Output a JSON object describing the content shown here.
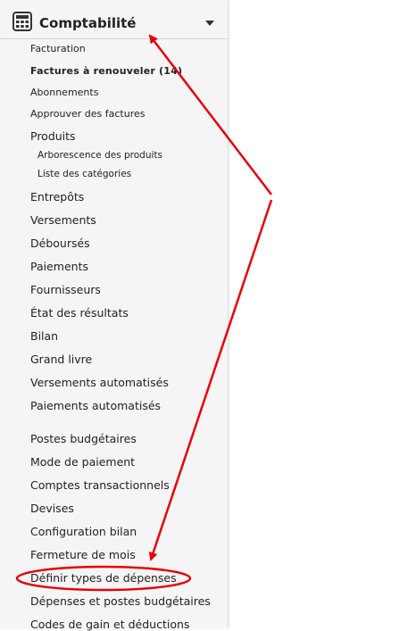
{
  "header": {
    "title": "Comptabilité",
    "icon": "calculator-icon"
  },
  "menu": {
    "facturation": "Facturation",
    "factures_renouveler": "Factures à renouveler (14)",
    "abonnements": "Abonnements",
    "approuver": "Approuver des factures",
    "produits": "Produits",
    "arborescence": "Arborescence des produits",
    "categories": "Liste des catégories",
    "entrepots": "Entrepôts",
    "versements": "Versements",
    "debourses": "Déboursés",
    "paiements": "Paiements",
    "fournisseurs": "Fournisseurs",
    "etat_resultats": "État des résultats",
    "bilan": "Bilan",
    "grand_livre": "Grand livre",
    "versements_auto": "Versements automatisés",
    "paiements_auto": "Paiements automatisés",
    "postes_budgetaires": "Postes budgétaires",
    "mode_paiement": "Mode de paiement",
    "comptes_trans": "Comptes transactionnels",
    "devises": "Devises",
    "config_bilan": "Configuration bilan",
    "fermeture_mois": "Fermeture de mois",
    "definir_types": "Définir types de dépenses",
    "depenses_postes": "Dépenses et postes budgétaires",
    "codes_gain": "Codes de gain et déductions"
  },
  "colors": {
    "annotation": "#e8000b",
    "sidebar_bg": "#f5f5f5"
  }
}
